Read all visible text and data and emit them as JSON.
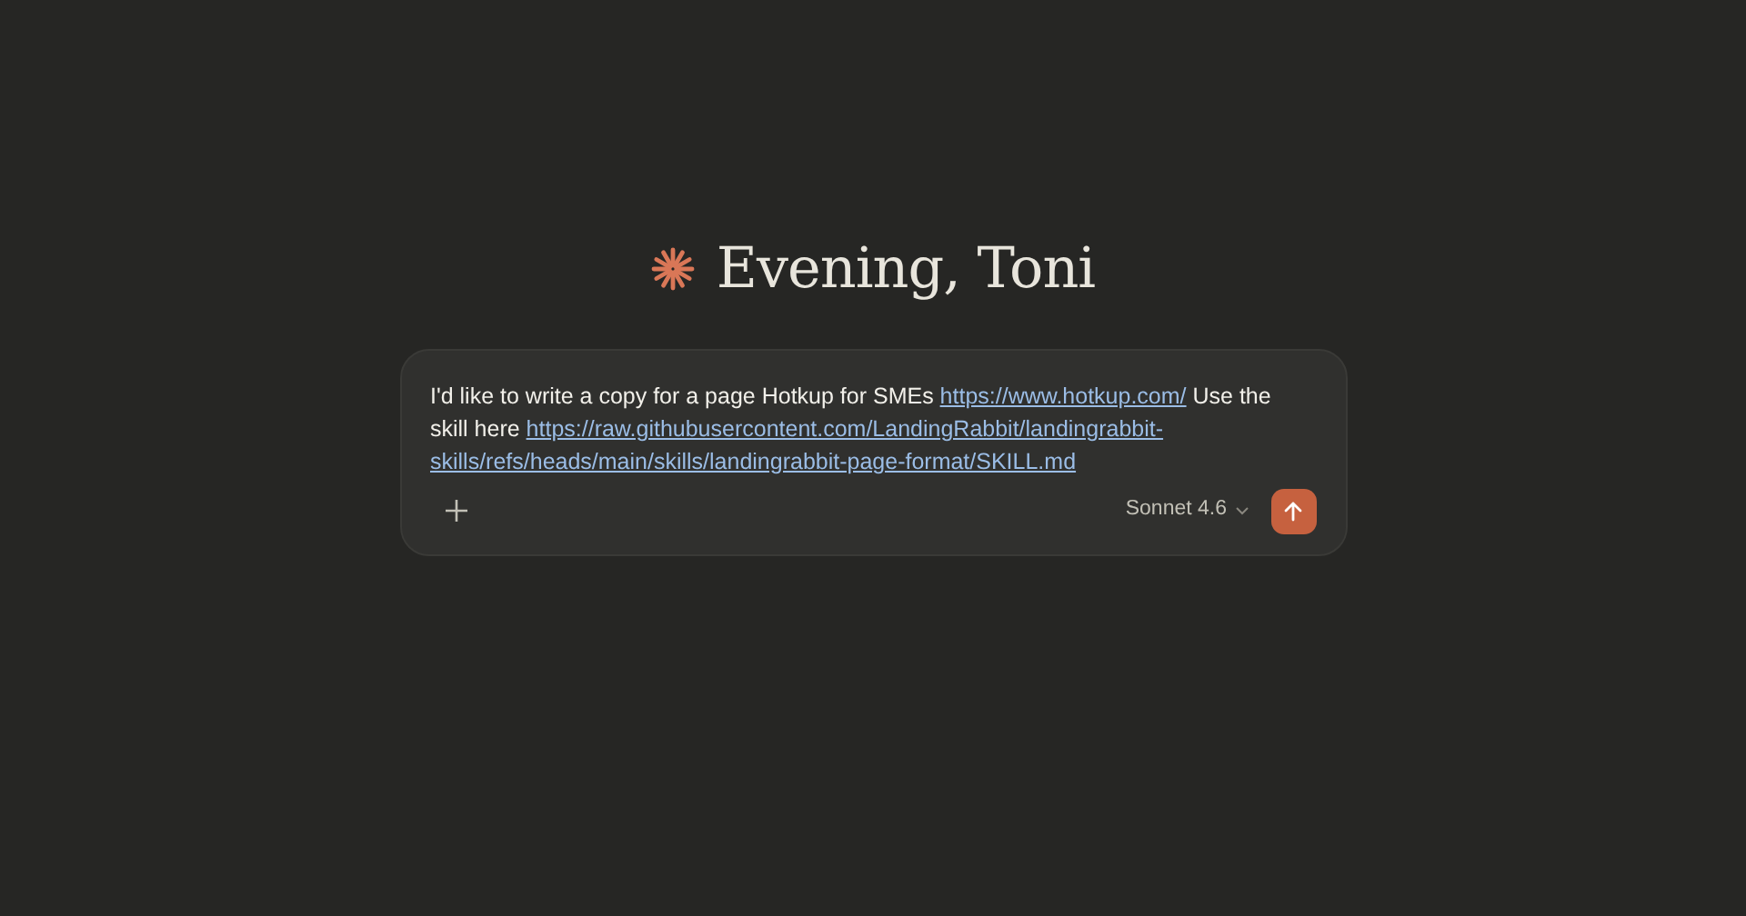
{
  "greeting": "Evening, Toni",
  "composer": {
    "message": [
      {
        "kind": "text",
        "text": "I'd like to write a copy for a page Hotkup for SMEs "
      },
      {
        "kind": "link",
        "text": "https://www.hotkup.com/"
      },
      {
        "kind": "text",
        "text": " Use the skill here "
      },
      {
        "kind": "link",
        "text": "https://raw.githubusercontent.com/LandingRabbit/landingrabbit-"
      },
      {
        "kind": "link",
        "text": "skills/refs/heads/main/skills/landingrabbit-page-format/SKILL.md"
      }
    ],
    "model": "Sonnet 4.6"
  }
}
